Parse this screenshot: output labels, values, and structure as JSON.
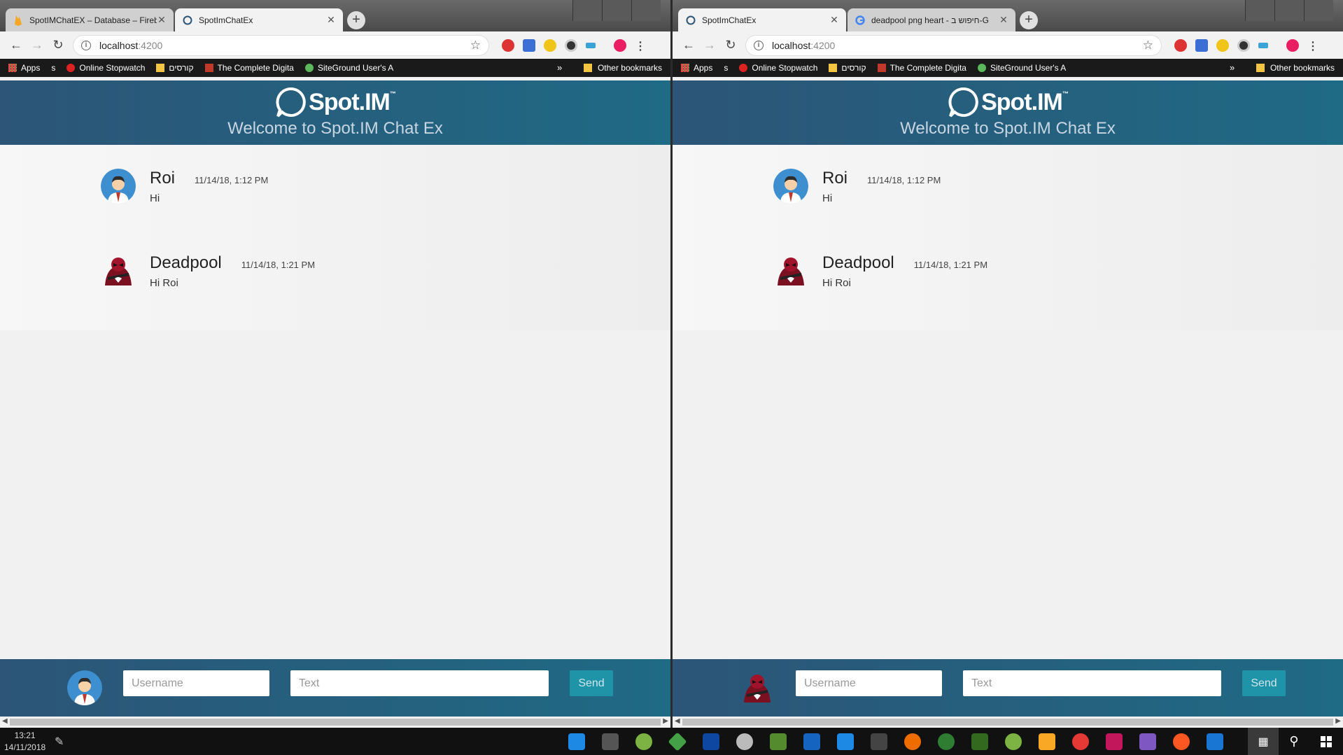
{
  "windows": [
    {
      "tabs": [
        {
          "title": "SpotIMChatEX – Database – Fireb",
          "active": false,
          "favicon": "firebase-icon"
        },
        {
          "title": "SpotImChatEx",
          "active": true,
          "favicon": "spotim-icon"
        }
      ],
      "url_host": "localhost",
      "url_port": ":4200",
      "footer_avatar": "roi",
      "new_tab": "+"
    },
    {
      "tabs": [
        {
          "title": "SpotImChatEx",
          "active": true,
          "favicon": "spotim-icon"
        },
        {
          "title": "deadpool png heart - חיפוש ב-G",
          "active": false,
          "favicon": "google-icon"
        }
      ],
      "url_host": "localhost",
      "url_port": ":4200",
      "footer_avatar": "deadpool",
      "new_tab": "+"
    }
  ],
  "bookmarks": {
    "apps": "Apps",
    "items": [
      "s",
      "Online Stopwatch",
      "קורסים",
      "The Complete Digita",
      "SiteGround User's A"
    ],
    "more": "»",
    "other": "Other bookmarks"
  },
  "app": {
    "logo_text": "Spot.IM",
    "logo_tm": "™",
    "welcome": "Welcome to Spot.IM Chat Ex",
    "messages": [
      {
        "user": "Roi",
        "time": "11/14/18, 1:12 PM",
        "text": "Hi",
        "avatar": "roi"
      },
      {
        "user": "Deadpool",
        "time": "11/14/18, 1:21 PM",
        "text": "Hi Roi",
        "avatar": "deadpool"
      }
    ],
    "username_placeholder": "Username",
    "text_placeholder": "Text",
    "send_label": "Send"
  },
  "taskbar": {
    "time": "13:21",
    "date": "14/11/2018"
  },
  "colors": {
    "header_start": "#2c5577",
    "header_end": "#1f6a85",
    "send_button": "#1f93a8",
    "welcome_text": "#c7d6e2"
  }
}
